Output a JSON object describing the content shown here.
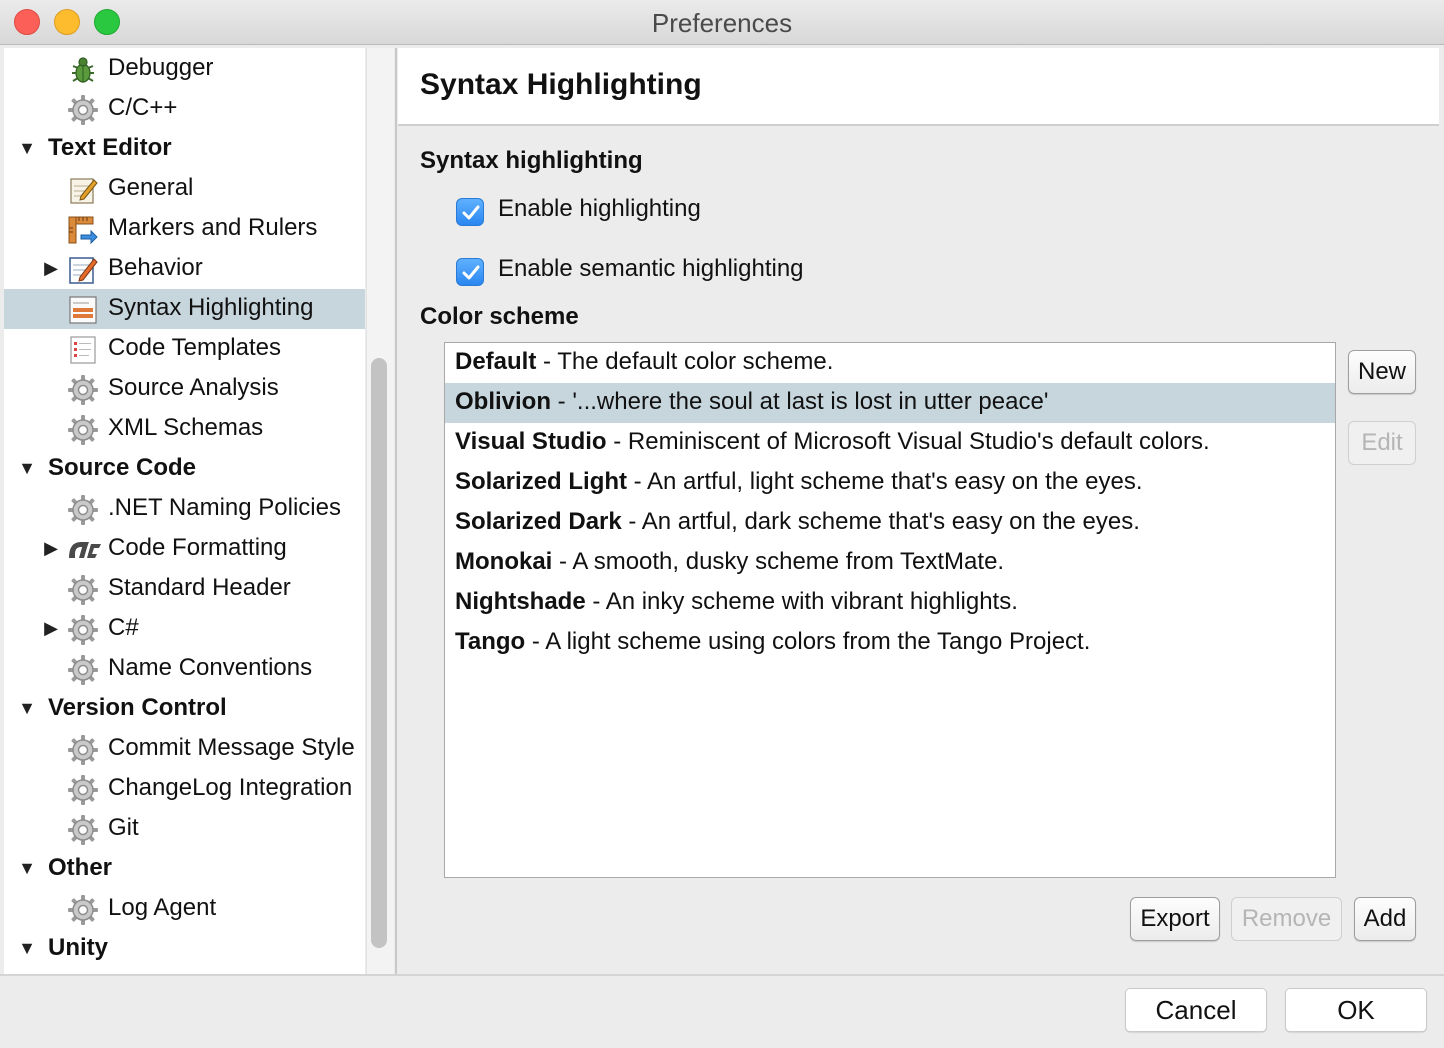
{
  "window": {
    "title": "Preferences"
  },
  "sidebar": {
    "items": [
      {
        "label": "Debugger",
        "icon": "bug-icon",
        "level": 1,
        "bold": false,
        "arrow": ""
      },
      {
        "label": "C/C++",
        "icon": "gear-icon",
        "level": 1,
        "bold": false,
        "arrow": ""
      },
      {
        "label": "Text Editor",
        "icon": "",
        "level": 0,
        "bold": true,
        "arrow": "expanded"
      },
      {
        "label": "General",
        "icon": "notepad-icon",
        "level": 1,
        "bold": false,
        "arrow": ""
      },
      {
        "label": "Markers and Rulers",
        "icon": "ruler-icon",
        "level": 1,
        "bold": false,
        "arrow": ""
      },
      {
        "label": "Behavior",
        "icon": "notepad-pencil-icon",
        "level": 1,
        "bold": false,
        "arrow": "collapsed"
      },
      {
        "label": "Syntax Highlighting",
        "icon": "syntax-icon",
        "level": 1,
        "bold": false,
        "arrow": "",
        "selected": true
      },
      {
        "label": "Code Templates",
        "icon": "template-icon",
        "level": 1,
        "bold": false,
        "arrow": ""
      },
      {
        "label": "Source Analysis",
        "icon": "gear-icon",
        "level": 1,
        "bold": false,
        "arrow": ""
      },
      {
        "label": "XML Schemas",
        "icon": "gear-icon",
        "level": 1,
        "bold": false,
        "arrow": ""
      },
      {
        "label": "Source Code",
        "icon": "",
        "level": 0,
        "bold": true,
        "arrow": "expanded"
      },
      {
        "label": ".NET Naming Policies",
        "icon": "gear-icon",
        "level": 1,
        "bold": false,
        "arrow": ""
      },
      {
        "label": "Code Formatting",
        "icon": "code-format-icon",
        "level": 1,
        "bold": false,
        "arrow": "collapsed"
      },
      {
        "label": "Standard Header",
        "icon": "gear-icon",
        "level": 1,
        "bold": false,
        "arrow": ""
      },
      {
        "label": "C#",
        "icon": "gear-icon",
        "level": 1,
        "bold": false,
        "arrow": "collapsed"
      },
      {
        "label": "Name Conventions",
        "icon": "gear-icon",
        "level": 1,
        "bold": false,
        "arrow": ""
      },
      {
        "label": "Version Control",
        "icon": "",
        "level": 0,
        "bold": true,
        "arrow": "expanded"
      },
      {
        "label": "Commit Message Style",
        "icon": "gear-icon",
        "level": 1,
        "bold": false,
        "arrow": ""
      },
      {
        "label": "ChangeLog Integration",
        "icon": "gear-icon",
        "level": 1,
        "bold": false,
        "arrow": ""
      },
      {
        "label": "Git",
        "icon": "gear-icon",
        "level": 1,
        "bold": false,
        "arrow": ""
      },
      {
        "label": "Other",
        "icon": "",
        "level": 0,
        "bold": true,
        "arrow": "expanded"
      },
      {
        "label": "Log Agent",
        "icon": "gear-icon",
        "level": 1,
        "bold": false,
        "arrow": ""
      },
      {
        "label": "Unity",
        "icon": "",
        "level": 0,
        "bold": true,
        "arrow": "expanded"
      }
    ]
  },
  "panel": {
    "title": "Syntax Highlighting",
    "syntax_section": "Syntax highlighting",
    "enable_highlighting": {
      "label": "Enable highlighting",
      "checked": true
    },
    "enable_semantic": {
      "label": "Enable semantic highlighting",
      "checked": true
    },
    "color_scheme_section": "Color scheme",
    "schemes": [
      {
        "name": "Default",
        "desc": " - The default color scheme."
      },
      {
        "name": "Oblivion",
        "desc": " - '...where the soul at last is lost in utter peace'",
        "selected": true
      },
      {
        "name": "Visual Studio",
        "desc": " - Reminiscent of Microsoft Visual Studio's default colors."
      },
      {
        "name": "Solarized Light",
        "desc": " - An artful, light scheme that's easy on the eyes."
      },
      {
        "name": "Solarized Dark",
        "desc": " - An artful, dark scheme that's easy on the eyes."
      },
      {
        "name": "Monokai",
        "desc": " - A smooth, dusky scheme from TextMate."
      },
      {
        "name": "Nightshade",
        "desc": " - An inky scheme with vibrant highlights."
      },
      {
        "name": "Tango",
        "desc": " - A light scheme using colors from the Tango Project."
      }
    ],
    "buttons": {
      "new": "New",
      "edit": "Edit",
      "export": "Export",
      "remove": "Remove",
      "add": "Add"
    }
  },
  "footer": {
    "cancel": "Cancel",
    "ok": "OK"
  },
  "colors": {
    "selection": "#c7d6dd",
    "checkbox": "#2a86f0"
  }
}
